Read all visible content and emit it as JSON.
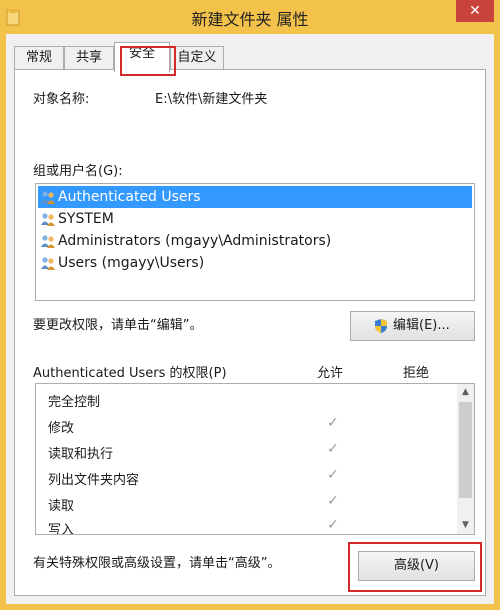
{
  "window": {
    "title": "新建文件夹 属性",
    "close_label": "✕"
  },
  "tabs": [
    {
      "label": "常规"
    },
    {
      "label": "共享"
    },
    {
      "label": "安全"
    },
    {
      "label": "自定义"
    }
  ],
  "active_tab": "安全",
  "object": {
    "label": "对象名称:",
    "value": "E:\\软件\\新建文件夹"
  },
  "groups": {
    "label": "组或用户名(G):",
    "items": [
      {
        "name": "Authenticated Users",
        "selected": true
      },
      {
        "name": "SYSTEM",
        "selected": false
      },
      {
        "name": "Administrators (mgayy\\Administrators)",
        "selected": false
      },
      {
        "name": "Users (mgayy\\Users)",
        "selected": false
      }
    ]
  },
  "edit": {
    "hint": "要更改权限，请单击“编辑”。",
    "button_label": "编辑(E)..."
  },
  "permissions": {
    "title": "Authenticated Users 的权限(P)",
    "allow_header": "允许",
    "deny_header": "拒绝",
    "rows": [
      {
        "name": "完全控制",
        "allow": "",
        "deny": ""
      },
      {
        "name": "修改",
        "allow": "✓",
        "deny": ""
      },
      {
        "name": "读取和执行",
        "allow": "✓",
        "deny": ""
      },
      {
        "name": "列出文件夹内容",
        "allow": "✓",
        "deny": ""
      },
      {
        "name": "读取",
        "allow": "✓",
        "deny": ""
      },
      {
        "name": "写入",
        "allow": "✓",
        "deny": ""
      }
    ]
  },
  "advanced": {
    "hint": "有关特殊权限或高级设置，请单击“高级”。",
    "button_label": "高级(V)"
  },
  "colors": {
    "title_bar": "#f3c24a",
    "selection": "#3399ff",
    "highlight_box": "#d22a2a",
    "close_button": "#c7433b"
  }
}
